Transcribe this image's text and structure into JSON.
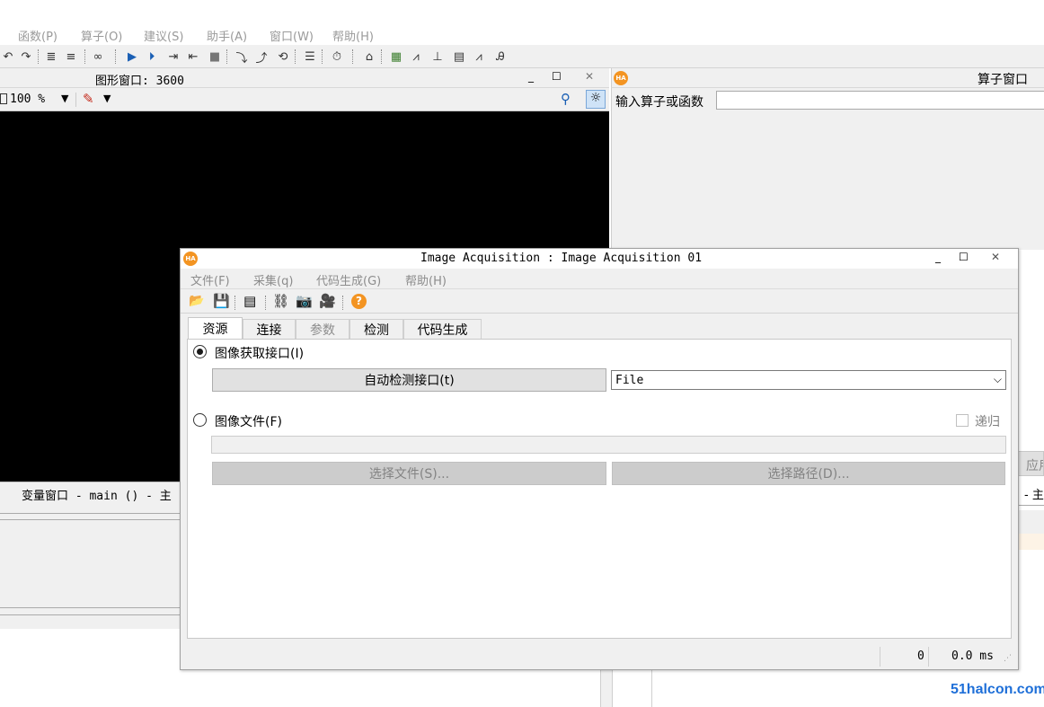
{
  "menubar": {
    "items": [
      "函数(P)",
      "算子(O)",
      "建议(S)",
      "助手(A)",
      "窗口(W)",
      "帮助(H)"
    ]
  },
  "graphics_window": {
    "title": "图形窗口: 3600",
    "zoom": "100 %"
  },
  "operator_window": {
    "title": "算子窗口",
    "input_label": "输入算子或函数",
    "input_value": ""
  },
  "variable_window": {
    "title": "变量窗口 - main () - 主"
  },
  "right_fragments": {
    "apply_partial": "应用",
    "dash_partial": "- 主"
  },
  "dialog": {
    "title": "Image Acquisition : Image Acquisition 01",
    "menu": [
      "文件(F)",
      "采集(q)",
      "代码生成(G)",
      "帮助(H)"
    ],
    "tabs": [
      "资源",
      "连接",
      "参数",
      "检测",
      "代码生成"
    ],
    "interface_radio_label": "图像获取接口(I)",
    "autodetect_button": "自动检测接口(t)",
    "interface_select": "File",
    "file_radio_label": "图像文件(F)",
    "recursive_label": "递归",
    "file_path_value": "",
    "select_files_button": "选择文件(S)...",
    "select_dir_button": "选择路径(D)...",
    "status": {
      "count": "0",
      "time": "0.0 ms"
    }
  },
  "watermark": "51halcon.com",
  "colors": {
    "canvas": "#000000",
    "logo": "#f39422",
    "watermark": "#1e6fd8"
  }
}
